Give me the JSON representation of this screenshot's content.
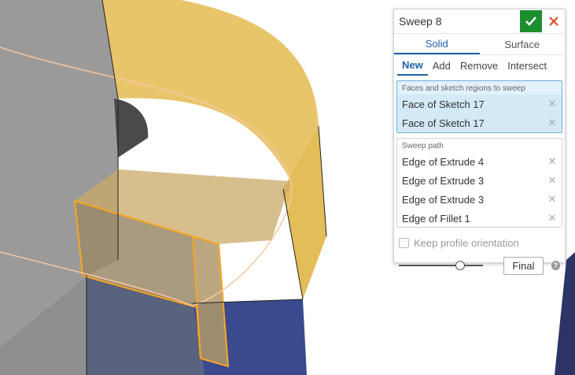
{
  "panel": {
    "title": "Sweep 8",
    "tabs": [
      {
        "label": "Solid"
      },
      {
        "label": "Surface"
      }
    ],
    "operations": [
      {
        "label": "New"
      },
      {
        "label": "Add"
      },
      {
        "label": "Remove"
      },
      {
        "label": "Intersect"
      }
    ],
    "faces": {
      "label": "Faces and sketch regions to sweep",
      "items": [
        "Face of Sketch 17",
        "Face of Sketch 17"
      ]
    },
    "path": {
      "label": "Sweep path",
      "items": [
        "Edge of Extrude 4",
        "Edge of Extrude 3",
        "Edge of Extrude 3",
        "Edge of Fillet 1"
      ]
    },
    "keep_orientation_label": "Keep profile orientation",
    "final_label": "Final",
    "help_glyph": "?"
  },
  "colors": {
    "accept": "#1d8e2e",
    "cancel": "#d9502a",
    "accent": "#1f5fa8",
    "sweep_body": "#e8c56a",
    "part_gray": "#9a9a9a",
    "part_blue": "#3a4a8f"
  }
}
